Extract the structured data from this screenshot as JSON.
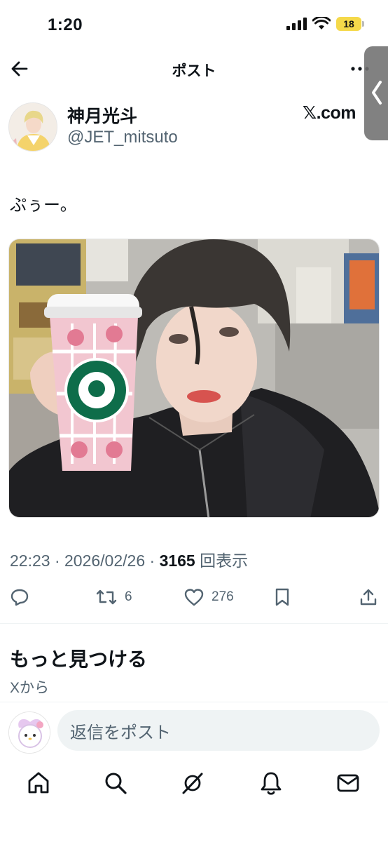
{
  "status": {
    "time": "1:20",
    "battery": "18"
  },
  "header": {
    "title": "ポスト"
  },
  "author": {
    "name": "神月光斗",
    "handle": "@JET_mitsuto",
    "source": "𝕏.com"
  },
  "tweet": {
    "text": "ぷぅー。",
    "timestamp": "22:23 · 2026/02/26 · ",
    "views": "3165",
    "views_label": " 回表示"
  },
  "actions": {
    "reposts": "6",
    "likes": "276"
  },
  "discover": {
    "title": "もっと見つける",
    "subtitle": "Xから"
  },
  "reply": {
    "placeholder": "返信をポスト"
  },
  "icons": {
    "back": "arrow-left-icon",
    "more": "more-dots-icon",
    "reply": "comment-icon",
    "repost": "repost-icon",
    "like": "heart-icon",
    "bookmark": "bookmark-icon",
    "share": "share-icon",
    "nav": [
      "home-icon",
      "search-icon",
      "grok-icon",
      "bell-icon",
      "mail-icon"
    ]
  }
}
